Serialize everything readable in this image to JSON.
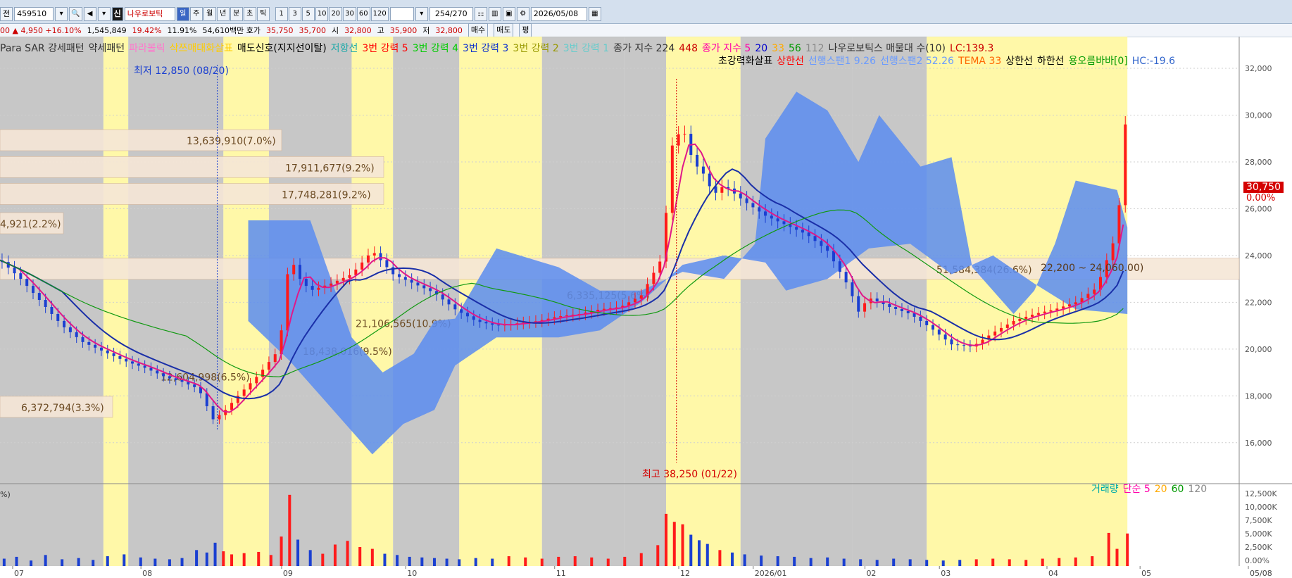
{
  "toolbar": {
    "mode_label": "전",
    "code": "459510",
    "badge": "신",
    "name": "나우로보틱",
    "periods": [
      "일",
      "주",
      "월",
      "년",
      "분",
      "초",
      "틱"
    ],
    "selected_period": "일",
    "intervals": [
      "1",
      "3",
      "5",
      "10",
      "20",
      "30",
      "60",
      "120"
    ],
    "count": "254/270",
    "date": "2026/05/08"
  },
  "quote": {
    "change": "00 ▲ 4,950 +16.10%",
    "volume": "1,545,849",
    "pct1": "19.42%",
    "pct2": "11.91%",
    "amount": "54,610백만 호가",
    "ask": "35,750",
    "bid": "35,700",
    "open_label": "시",
    "open": "32,800",
    "high_label": "고",
    "high": "35,900",
    "low_label": "저",
    "low": "32,800",
    "buy_label": "매수",
    "sell_label": "매도",
    "extra_label": "평"
  },
  "legend_row1": [
    {
      "text": "Para SAR 강세패턴",
      "color": "#333333"
    },
    {
      "text": "약세패턴",
      "color": "#333333"
    },
    {
      "text": "파라볼릭",
      "color": "#ff77cc"
    },
    {
      "text": "삭쯔매대화살표",
      "color": "#ffcc00"
    },
    {
      "text": "매도신호(지지선이탈)",
      "color": "#000000"
    },
    {
      "text": "저항선",
      "color": "#22aaaa"
    },
    {
      "text": "3번 강력 5",
      "color": "#ff0000"
    },
    {
      "text": "3번 강력 4",
      "color": "#00cc00"
    },
    {
      "text": "3번 강력 3",
      "color": "#1133cc"
    },
    {
      "text": "3번 강력 2",
      "color": "#999900"
    },
    {
      "text": "3번 강력 1",
      "color": "#66cccc"
    },
    {
      "text": "종가 지수 224",
      "color": "#333333"
    },
    {
      "text": "448",
      "color": "#cc0000"
    },
    {
      "text": "종가 지수 5",
      "color": "#ff00aa"
    },
    {
      "text": "20",
      "color": "#0000cc"
    },
    {
      "text": "33",
      "color": "#ffaa00"
    },
    {
      "text": "56",
      "color": "#009900"
    },
    {
      "text": "112",
      "color": "#888888"
    },
    {
      "text": "나우로보틱스 매물대 수(10)",
      "color": "#333333"
    },
    {
      "text": "LC:139.3",
      "color": "#cc0000"
    }
  ],
  "legend_row2": [
    {
      "text": "초강력화살표",
      "color": "#000000"
    },
    {
      "text": "상한선",
      "color": "#ff0000"
    },
    {
      "text": "선행스팬1 9.26",
      "color": "#6a9bff"
    },
    {
      "text": "선행스팬2 52.26",
      "color": "#6a9bff"
    },
    {
      "text": "TEMA 33",
      "color": "#ff6600"
    },
    {
      "text": "상한선",
      "color": "#000000"
    },
    {
      "text": "하한선",
      "color": "#000000"
    },
    {
      "text": "용오름바바[0]",
      "color": "#009900"
    },
    {
      "text": "HC:-19.6",
      "color": "#3366cc"
    }
  ],
  "volume_legend": [
    {
      "text": "거래량",
      "color": "#00aaaa"
    },
    {
      "text": "단순 5",
      "color": "#ff00aa"
    },
    {
      "text": "20",
      "color": "#ffaa00"
    },
    {
      "text": "60",
      "color": "#009900"
    },
    {
      "text": "120",
      "color": "#888888"
    }
  ],
  "annotations": {
    "low_marker": "최저 12,850 (08/20)",
    "high_marker": "최고 38,250 (01/22)",
    "price_tag": "30,750",
    "price_pct": "0.00%",
    "range_label": "22,200 ~ 24,060.00)",
    "pct_axis_label": "%)"
  },
  "chart_data": {
    "type": "candlestick",
    "y_axis": {
      "min": 15000,
      "max": 32000,
      "ticks": [
        "32,000",
        "30,000",
        "28,000",
        "26,000",
        "24,000",
        "22,000",
        "20,000",
        "18,000",
        "16,000"
      ]
    },
    "volume_axis": {
      "ticks": [
        "12,500K",
        "10,000K",
        "7,500K",
        "5,000K",
        "2,500K",
        "0.00%"
      ]
    },
    "x_labels": [
      "07",
      "08",
      "09",
      "10",
      "11",
      "12",
      "2026/01",
      "02",
      "03",
      "04",
      "05",
      "05/08"
    ],
    "volume_profile": [
      {
        "label": "13,639,910(7.0%)",
        "price": 28900
      },
      {
        "label": "17,911,677(9.2%)",
        "price": 27750
      },
      {
        "label": "17,748,281(9.2%)",
        "price": 26600
      },
      {
        "label": "4,921(2.2%)",
        "price": 25350
      },
      {
        "label": "51,584,384(26.6%)",
        "price": 23400
      },
      {
        "label": "6,335,125(5.6%)",
        "price": 22300
      },
      {
        "label": "21,106,565(10.9%)",
        "price": 21100
      },
      {
        "label": "18,438,016(9.5%)",
        "price": 19900
      },
      {
        "label": "12,604,998(6.5%)",
        "price": 18800
      },
      {
        "label": "6,372,794(3.3%)",
        "price": 17500
      }
    ],
    "close_path": [
      [
        0,
        23800
      ],
      [
        10,
        23000
      ],
      [
        20,
        22000
      ],
      [
        30,
        21000
      ],
      [
        40,
        20300
      ],
      [
        50,
        19900
      ],
      [
        60,
        19500
      ],
      [
        70,
        19200
      ],
      [
        80,
        18800
      ],
      [
        88,
        18600
      ],
      [
        96,
        18300
      ],
      [
        103,
        17000
      ],
      [
        108,
        17300
      ],
      [
        115,
        18000
      ],
      [
        125,
        18900
      ],
      [
        135,
        20000
      ],
      [
        140,
        24000
      ],
      [
        145,
        23000
      ],
      [
        150,
        22500
      ],
      [
        160,
        22800
      ],
      [
        170,
        23200
      ],
      [
        180,
        24200
      ],
      [
        190,
        23200
      ],
      [
        200,
        22800
      ],
      [
        210,
        22400
      ],
      [
        220,
        21700
      ],
      [
        230,
        21200
      ],
      [
        240,
        21000
      ],
      [
        250,
        21100
      ],
      [
        260,
        21200
      ],
      [
        270,
        21400
      ],
      [
        280,
        21500
      ],
      [
        290,
        21700
      ],
      [
        300,
        21800
      ],
      [
        310,
        22300
      ],
      [
        320,
        23900
      ],
      [
        325,
        28700
      ],
      [
        330,
        29500
      ],
      [
        335,
        28000
      ],
      [
        340,
        27500
      ],
      [
        345,
        26600
      ],
      [
        350,
        27000
      ],
      [
        360,
        26300
      ],
      [
        370,
        25700
      ],
      [
        380,
        25300
      ],
      [
        390,
        24900
      ],
      [
        400,
        24200
      ],
      [
        410,
        22700
      ],
      [
        415,
        21600
      ],
      [
        420,
        22200
      ],
      [
        430,
        21800
      ],
      [
        440,
        21500
      ],
      [
        450,
        20900
      ],
      [
        460,
        20200
      ],
      [
        470,
        20100
      ],
      [
        480,
        20700
      ],
      [
        490,
        21200
      ],
      [
        500,
        21500
      ],
      [
        510,
        21700
      ],
      [
        520,
        22000
      ],
      [
        530,
        22600
      ],
      [
        540,
        25000
      ],
      [
        545,
        30750
      ]
    ],
    "volume_bars": [
      {
        "day": 2,
        "value": 1200
      },
      {
        "day": 8,
        "value": 1500
      },
      {
        "day": 15,
        "value": 900
      },
      {
        "day": 22,
        "value": 1800
      },
      {
        "day": 30,
        "value": 1100
      },
      {
        "day": 38,
        "value": 1300
      },
      {
        "day": 45,
        "value": 1000
      },
      {
        "day": 52,
        "value": 1600
      },
      {
        "day": 60,
        "value": 1900
      },
      {
        "day": 68,
        "value": 1400
      },
      {
        "day": 75,
        "value": 1200
      },
      {
        "day": 82,
        "value": 1100
      },
      {
        "day": 88,
        "value": 1300
      },
      {
        "day": 95,
        "value": 2600
      },
      {
        "day": 100,
        "value": 2200
      },
      {
        "day": 104,
        "value": 3800
      },
      {
        "day": 108,
        "value": 2400
      },
      {
        "day": 112,
        "value": 1900
      },
      {
        "day": 118,
        "value": 2100
      },
      {
        "day": 125,
        "value": 2300
      },
      {
        "day": 131,
        "value": 1800
      },
      {
        "day": 136,
        "value": 4800
      },
      {
        "day": 140,
        "value": 11600
      },
      {
        "day": 144,
        "value": 4300
      },
      {
        "day": 150,
        "value": 2600
      },
      {
        "day": 156,
        "value": 2000
      },
      {
        "day": 162,
        "value": 3500
      },
      {
        "day": 168,
        "value": 4100
      },
      {
        "day": 174,
        "value": 3100
      },
      {
        "day": 180,
        "value": 2800
      },
      {
        "day": 186,
        "value": 2000
      },
      {
        "day": 192,
        "value": 1800
      },
      {
        "day": 198,
        "value": 1500
      },
      {
        "day": 204,
        "value": 1400
      },
      {
        "day": 210,
        "value": 1300
      },
      {
        "day": 216,
        "value": 1200
      },
      {
        "day": 222,
        "value": 1100
      },
      {
        "day": 230,
        "value": 1300
      },
      {
        "day": 238,
        "value": 1200
      },
      {
        "day": 246,
        "value": 1600
      },
      {
        "day": 254,
        "value": 1400
      },
      {
        "day": 262,
        "value": 1200
      },
      {
        "day": 270,
        "value": 1500
      },
      {
        "day": 278,
        "value": 1600
      },
      {
        "day": 286,
        "value": 1400
      },
      {
        "day": 294,
        "value": 1200
      },
      {
        "day": 302,
        "value": 1500
      },
      {
        "day": 310,
        "value": 2100
      },
      {
        "day": 318,
        "value": 3400
      },
      {
        "day": 322,
        "value": 8500
      },
      {
        "day": 326,
        "value": 7200
      },
      {
        "day": 330,
        "value": 6800
      },
      {
        "day": 334,
        "value": 5100
      },
      {
        "day": 338,
        "value": 4200
      },
      {
        "day": 342,
        "value": 3600
      },
      {
        "day": 348,
        "value": 2600
      },
      {
        "day": 354,
        "value": 2200
      },
      {
        "day": 360,
        "value": 1900
      },
      {
        "day": 368,
        "value": 1700
      },
      {
        "day": 376,
        "value": 1600
      },
      {
        "day": 384,
        "value": 1500
      },
      {
        "day": 392,
        "value": 1300
      },
      {
        "day": 400,
        "value": 1400
      },
      {
        "day": 408,
        "value": 1200
      },
      {
        "day": 416,
        "value": 1100
      },
      {
        "day": 424,
        "value": 1000
      },
      {
        "day": 432,
        "value": 1200
      },
      {
        "day": 440,
        "value": 1100
      },
      {
        "day": 448,
        "value": 1000
      },
      {
        "day": 456,
        "value": 900
      },
      {
        "day": 464,
        "value": 1000
      },
      {
        "day": 472,
        "value": 1100
      },
      {
        "day": 480,
        "value": 1200
      },
      {
        "day": 488,
        "value": 1100
      },
      {
        "day": 496,
        "value": 1000
      },
      {
        "day": 504,
        "value": 1200
      },
      {
        "day": 512,
        "value": 1300
      },
      {
        "day": 520,
        "value": 1400
      },
      {
        "day": 528,
        "value": 1600
      },
      {
        "day": 536,
        "value": 5400
      },
      {
        "day": 540,
        "value": 2800
      },
      {
        "day": 545,
        "value": 5300
      }
    ],
    "colors": {
      "up": "#ff1a1a",
      "down": "#1a3fd1",
      "ichimoku_cloud": "#5b8cf0",
      "yellow_band": "#fff799",
      "gray_band": "#bdbdbd",
      "profile_box": "#f6e7d7"
    }
  }
}
